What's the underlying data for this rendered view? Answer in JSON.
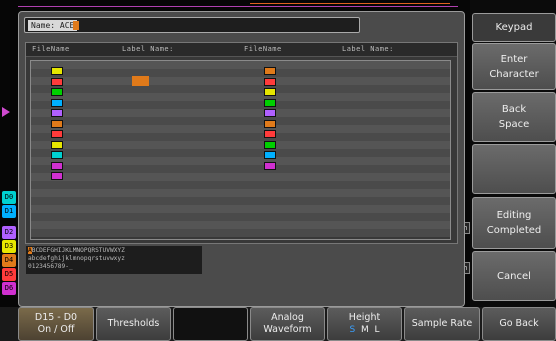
{
  "name_field": {
    "label": "Name: ACE"
  },
  "columns": {
    "file_name": "FileName",
    "label_name": "Label Name:",
    "file_name_2": "FileName",
    "label_name_2": "Label Name:"
  },
  "file_list_left": [
    {
      "id": "D0",
      "color": "#e6e600"
    },
    {
      "id": "D1",
      "color": "#ff3b3b"
    },
    {
      "id": "D2",
      "color": "#00d000"
    },
    {
      "id": "D3",
      "color": "#00b0ff"
    },
    {
      "id": "D4",
      "color": "#b060ff"
    },
    {
      "id": "D5",
      "color": "#e07a1a"
    },
    {
      "id": "D6",
      "color": "#ff3b3b"
    },
    {
      "id": "D7",
      "color": "#e6e600"
    },
    {
      "id": "D8",
      "color": "#00d0d0"
    },
    {
      "id": "D9",
      "color": "#d030d0"
    },
    {
      "id": "D10",
      "color": "#d030d0"
    }
  ],
  "file_list_right": [
    {
      "id": "D11",
      "color": "#e07a1a"
    },
    {
      "id": "D12",
      "color": "#ff3b3b"
    },
    {
      "id": "D13",
      "color": "#e6e600"
    },
    {
      "id": "D14",
      "color": "#00d000"
    },
    {
      "id": "D15",
      "color": "#b060ff"
    },
    {
      "id": "D16",
      "color": "#e07a1a"
    },
    {
      "id": "D17",
      "color": "#ff3b3b"
    },
    {
      "id": "D18",
      "color": "#00d000"
    },
    {
      "id": "D19",
      "color": "#00b0ff"
    },
    {
      "id": "D20",
      "color": "#d030d0"
    }
  ],
  "keyboard": {
    "line1_sel": "A",
    "line1": "BCDEFGHIJKLMNOPQRSTUVWXYZ",
    "line2": "abcdefghijklmnopqrstuvwxyz",
    "line3": "0123456789-_"
  },
  "softkeys": {
    "title": "Keypad",
    "enter_1": "Enter",
    "enter_2": "Character",
    "back_1": "Back",
    "back_2": "Space",
    "editing_1": "Editing",
    "editing_2": "Completed",
    "cancel": "Cancel"
  },
  "bottom_menu": {
    "d15_1": "D15 - D0",
    "d15_2": "On / Off",
    "thresholds": "Thresholds",
    "analog_1": "Analog",
    "analog_2": "Waveform",
    "height": "Height",
    "height_s": "S",
    "height_m": "M",
    "height_l": "L",
    "sample_rate": "Sample Rate",
    "go_back": "Go Back"
  },
  "colors": {
    "accent": "#e07a1a",
    "selected_height": "#39a0ff"
  }
}
